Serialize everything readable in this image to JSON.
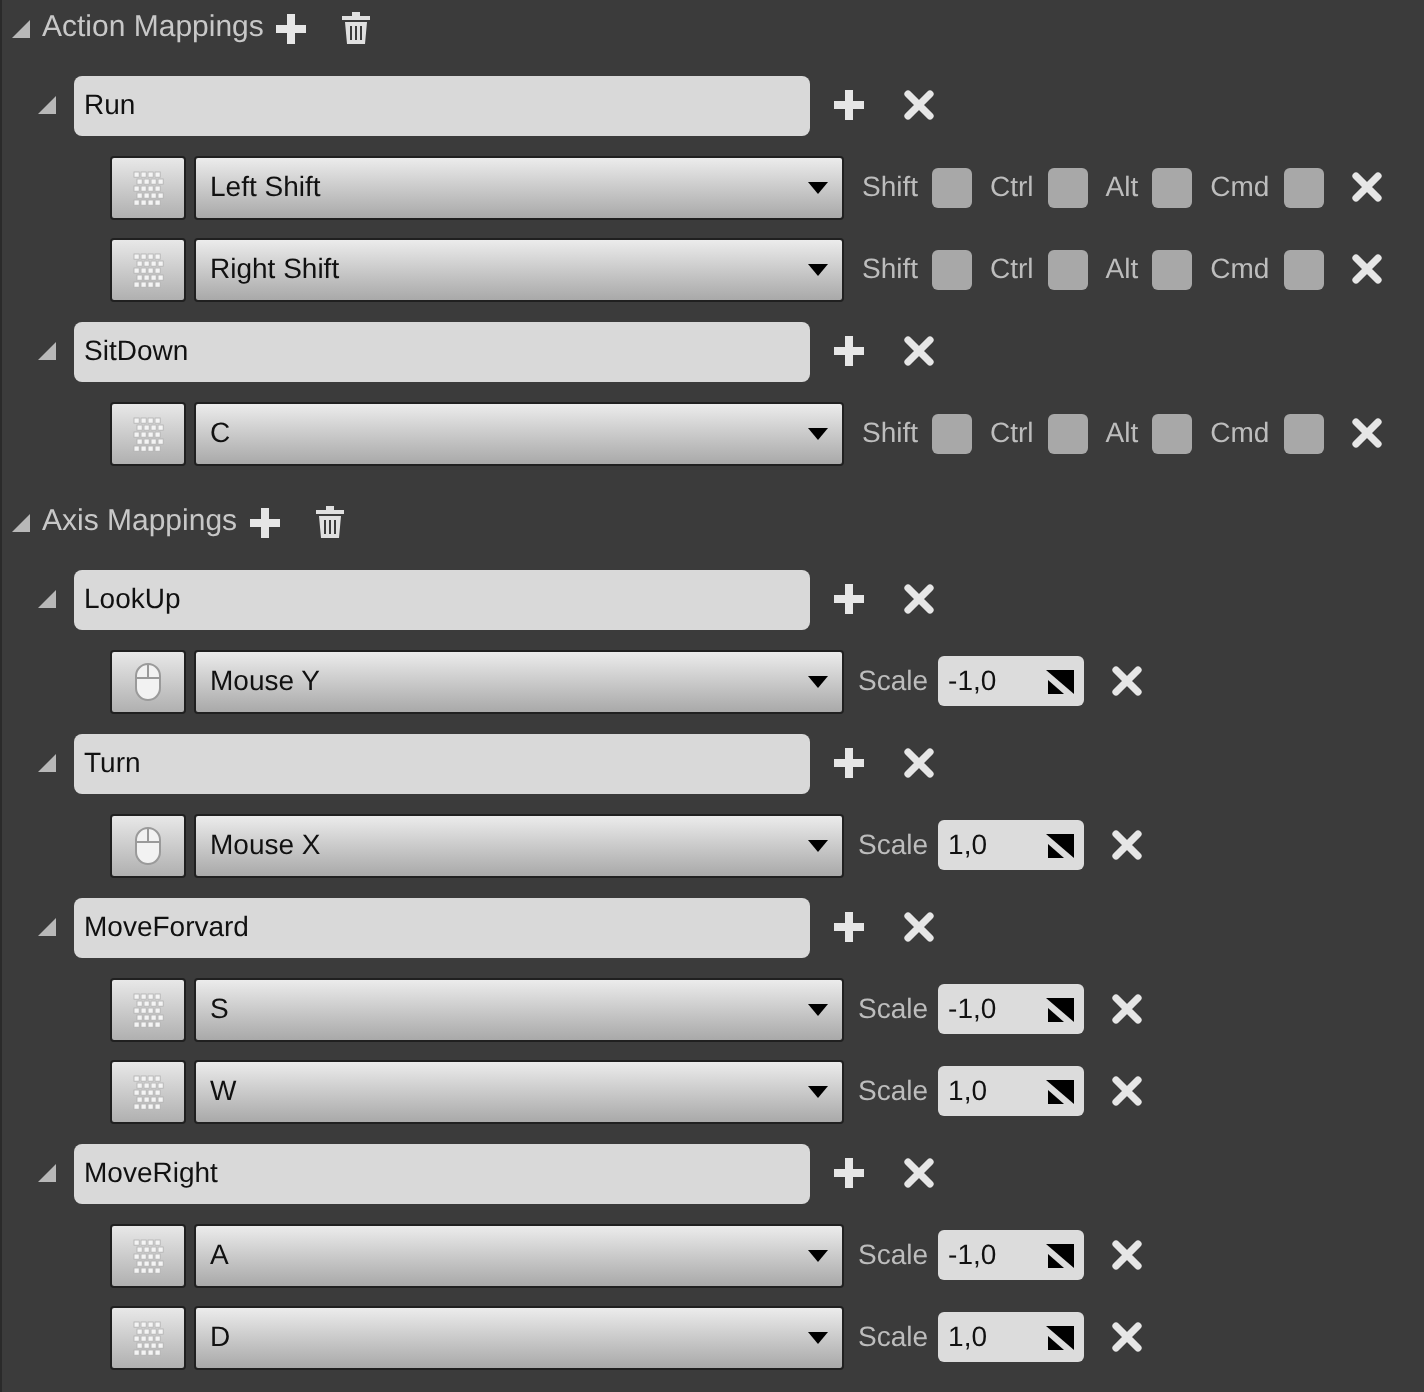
{
  "sections": [
    {
      "title": "Action Mappings",
      "expanded": true,
      "mappings": [
        {
          "name": "Run",
          "expanded": true,
          "keys": [
            {
              "kind": "modifiers",
              "device_icon": {
                "kind": "keyboard"
              },
              "key": "Left Shift",
              "modifiers": [
                {
                  "label": "Shift",
                  "checked": false
                },
                {
                  "label": "Ctrl",
                  "checked": false
                },
                {
                  "label": "Alt",
                  "checked": false
                },
                {
                  "label": "Cmd",
                  "checked": false
                }
              ]
            },
            {
              "kind": "modifiers",
              "device_icon": {
                "kind": "keyboard"
              },
              "key": "Right Shift",
              "modifiers": [
                {
                  "label": "Shift",
                  "checked": false
                },
                {
                  "label": "Ctrl",
                  "checked": false
                },
                {
                  "label": "Alt",
                  "checked": false
                },
                {
                  "label": "Cmd",
                  "checked": false
                }
              ]
            }
          ]
        },
        {
          "name": "SitDown",
          "expanded": true,
          "keys": [
            {
              "kind": "modifiers",
              "device_icon": {
                "kind": "keyboard"
              },
              "key": "C",
              "modifiers": [
                {
                  "label": "Shift",
                  "checked": false
                },
                {
                  "label": "Ctrl",
                  "checked": false
                },
                {
                  "label": "Alt",
                  "checked": false
                },
                {
                  "label": "Cmd",
                  "checked": false
                }
              ]
            }
          ]
        }
      ]
    },
    {
      "title": "Axis Mappings",
      "expanded": true,
      "mappings": [
        {
          "name": "LookUp",
          "expanded": true,
          "keys": [
            {
              "kind": "scale",
              "device_icon": {
                "kind": "mouse"
              },
              "key": "Mouse Y",
              "scale_label": "Scale",
              "scale": "-1,0"
            }
          ]
        },
        {
          "name": "Turn",
          "expanded": true,
          "keys": [
            {
              "kind": "scale",
              "device_icon": {
                "kind": "mouse"
              },
              "key": "Mouse X",
              "scale_label": "Scale",
              "scale": "1,0"
            }
          ]
        },
        {
          "name": "MoveForvard",
          "expanded": true,
          "keys": [
            {
              "kind": "scale",
              "device_icon": {
                "kind": "keyboard"
              },
              "key": "S",
              "scale_label": "Scale",
              "scale": "-1,0"
            },
            {
              "kind": "scale",
              "device_icon": {
                "kind": "keyboard"
              },
              "key": "W",
              "scale_label": "Scale",
              "scale": "1,0"
            }
          ]
        },
        {
          "name": "MoveRight",
          "expanded": true,
          "keys": [
            {
              "kind": "scale",
              "device_icon": {
                "kind": "keyboard"
              },
              "key": "A",
              "scale_label": "Scale",
              "scale": "-1,0"
            },
            {
              "kind": "scale",
              "device_icon": {
                "kind": "keyboard"
              },
              "key": "D",
              "scale_label": "Scale",
              "scale": "1,0"
            }
          ]
        }
      ]
    }
  ]
}
